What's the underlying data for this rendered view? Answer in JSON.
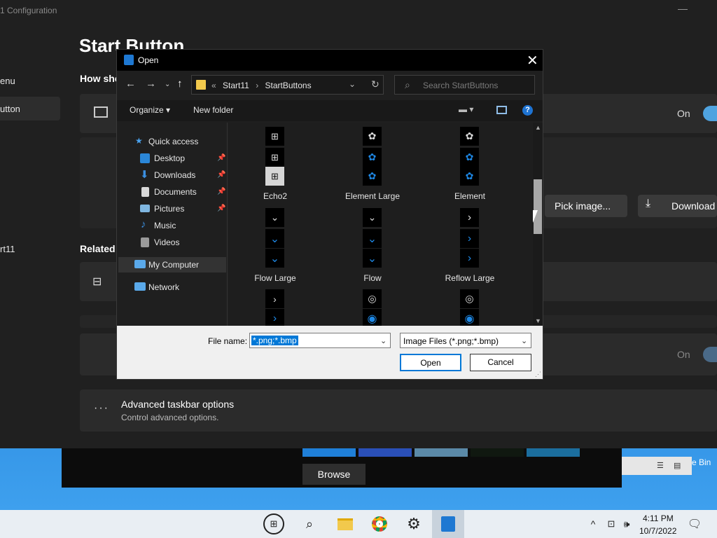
{
  "app": {
    "title": "1 Configuration",
    "page_title": "Start Button",
    "section_1": "How sho",
    "section_2": "Related",
    "nav": [
      "enu",
      "utton",
      "rt11"
    ],
    "toggle_on": "On",
    "pick_image": "Pick image...",
    "download": "Download",
    "advanced_title": "Advanced taskbar options",
    "advanced_subtitle": "Control advanced options."
  },
  "desktop": {
    "browse": "Browse",
    "bin_label": "e Bin"
  },
  "taskbar": {
    "time": "4:11 PM",
    "date": "10/7/2022"
  },
  "dialog": {
    "title": "Open",
    "close": "✕",
    "address": {
      "prefix": "«",
      "path": [
        "Start11",
        "StartButtons"
      ]
    },
    "search_placeholder": "Search StartButtons",
    "organize": "Organize ▾",
    "new_folder": "New folder",
    "help": "?",
    "tree": {
      "quick_access": "Quick access",
      "desktop": "Desktop",
      "downloads": "Downloads",
      "documents": "Documents",
      "pictures": "Pictures",
      "music": "Music",
      "videos": "Videos",
      "my_computer": "My Computer",
      "network": "Network"
    },
    "files": [
      {
        "label": "Echo2"
      },
      {
        "label": "Element Large"
      },
      {
        "label": "Element"
      },
      {
        "label": "Flow Large"
      },
      {
        "label": "Flow"
      },
      {
        "label": "Reflow Large"
      }
    ],
    "filename_label": "File name:",
    "filename_value": "*.png;*.bmp",
    "filetype_value": "Image Files (*.png;*.bmp)",
    "open_button": "Open",
    "cancel_button": "Cancel"
  },
  "colors": {
    "accent": "#0078d7",
    "toggle": "#4fa3e0",
    "tile_blue": "#1e88e5"
  }
}
